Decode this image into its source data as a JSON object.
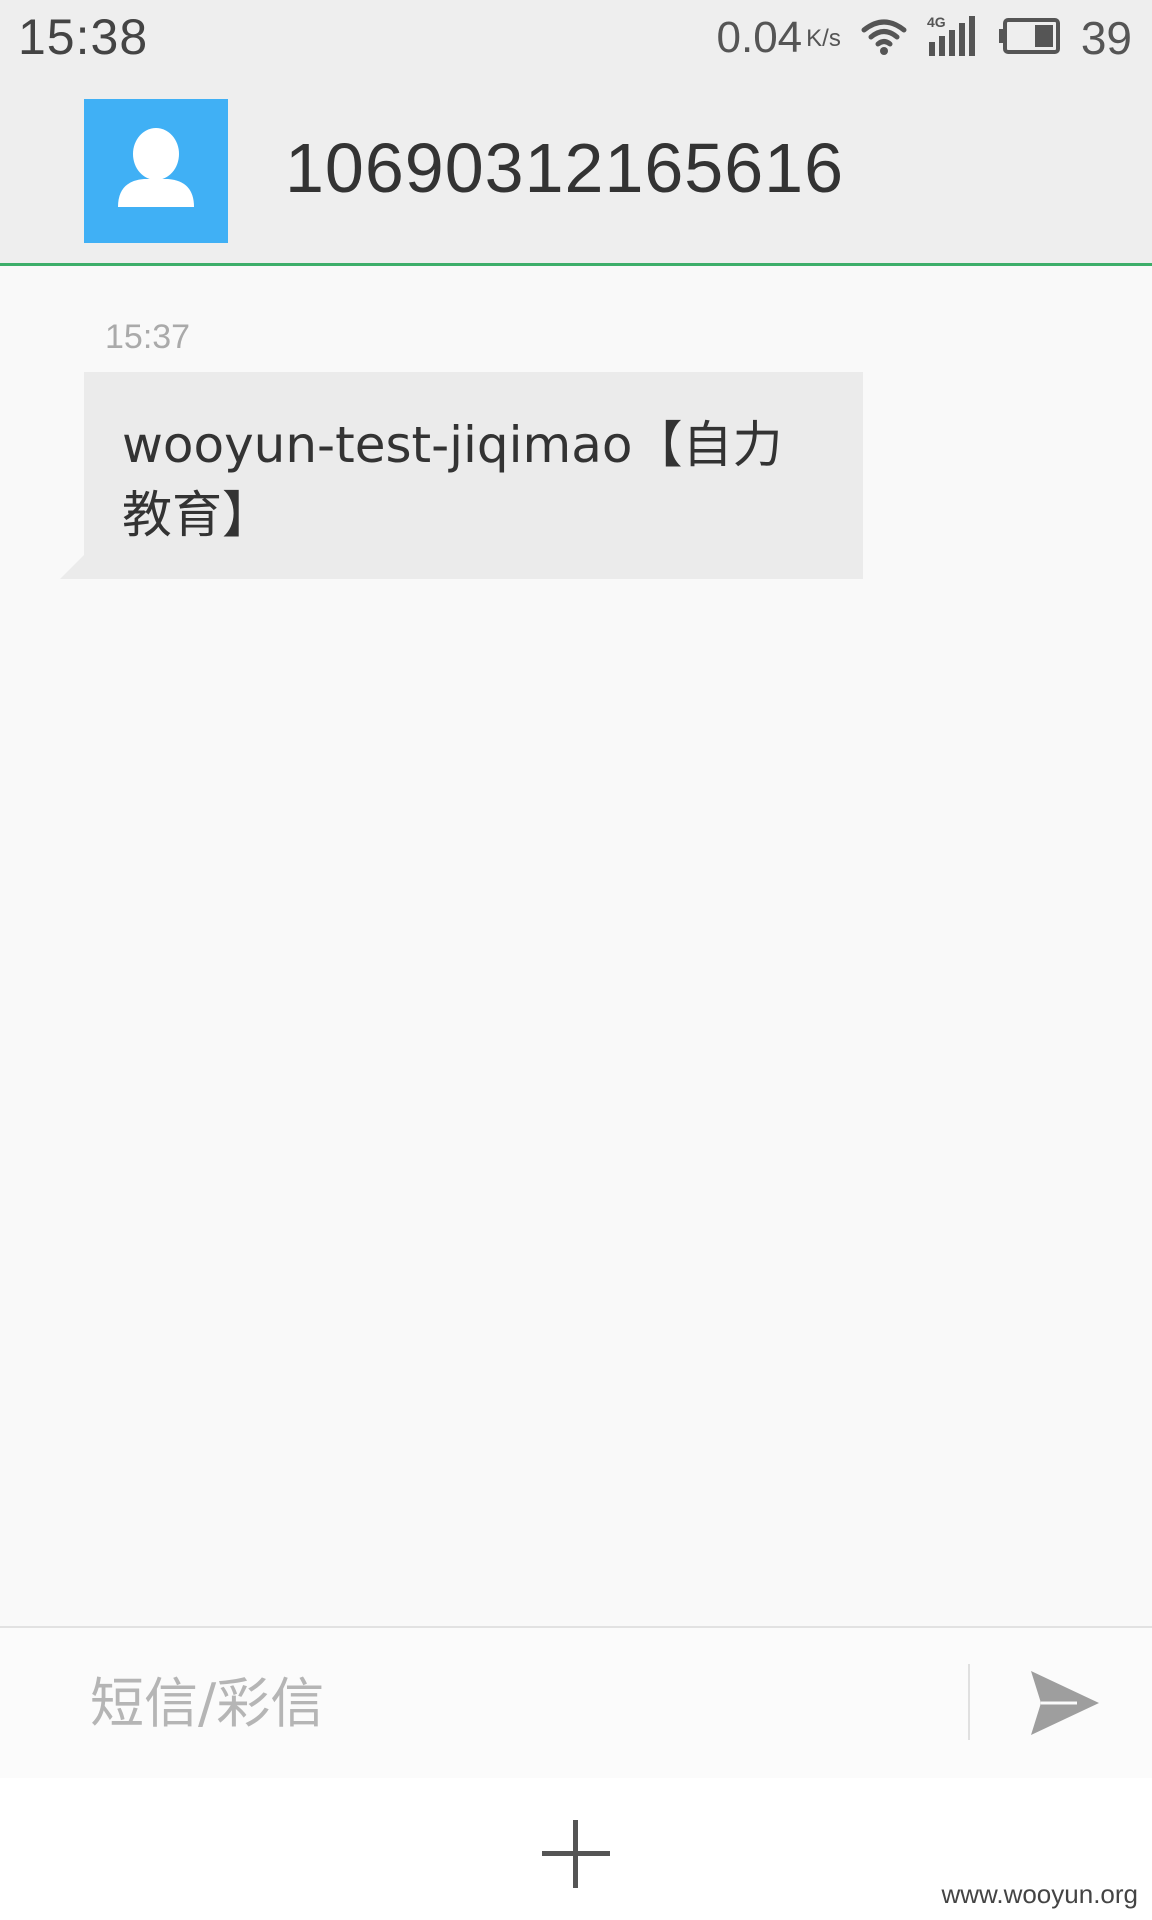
{
  "status_bar": {
    "time": "15:38",
    "net_speed": "0.04",
    "net_unit": "K/s",
    "battery": "39",
    "icons": [
      "wifi-icon",
      "signal-4g-icon",
      "battery-icon"
    ]
  },
  "header": {
    "contact": "10690312165616",
    "avatar_icon": "person-icon",
    "avatar_color": "#40b0f5",
    "accent_color": "#3dae6a"
  },
  "conversation": {
    "messages": [
      {
        "time": "15:37",
        "text": "wooyun-test-jiqimao【自力教育】"
      }
    ]
  },
  "composer": {
    "placeholder": "短信/彩信",
    "send_icon": "send-icon",
    "add_icon": "plus-icon"
  },
  "watermark": "www.wooyun.org"
}
